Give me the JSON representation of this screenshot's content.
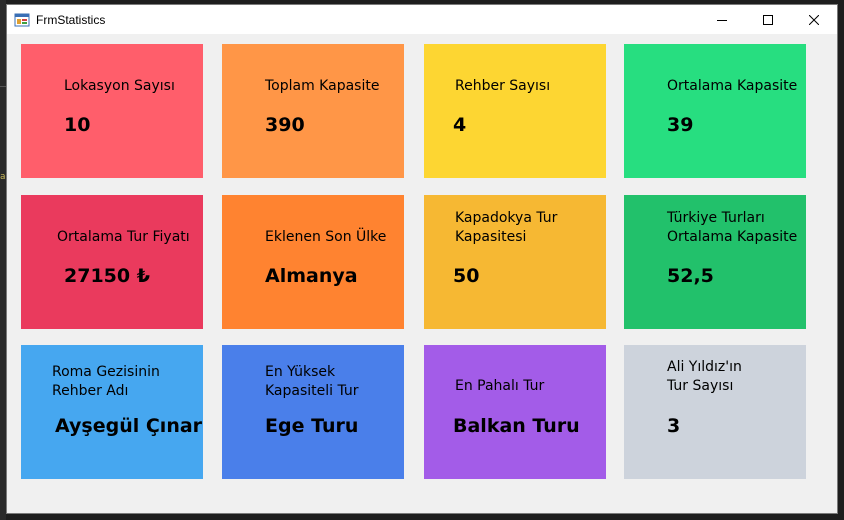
{
  "window": {
    "title": "FrmStatistics",
    "controls": {
      "minimize_icon": "minimize-icon",
      "maximize_icon": "maximize-icon",
      "close_icon": "close-icon"
    }
  },
  "tiles": [
    {
      "label": "Lokasyon Sayısı",
      "value": "10",
      "color": "#ff5e6b"
    },
    {
      "label": "Toplam Kapasite",
      "value": "390",
      "color": "#ff9647"
    },
    {
      "label": "Rehber Sayısı",
      "value": "4",
      "color": "#fdd632"
    },
    {
      "label": "Ortalama Kapasite",
      "value": "39",
      "color": "#27de80"
    },
    {
      "label": "Ortalama Tur Fiyatı",
      "value": "27150 ₺",
      "color": "#ea3a5d"
    },
    {
      "label": "Eklenen Son Ülke",
      "value": "Almanya",
      "color": "#ff8330"
    },
    {
      "label": "Kapadokya Tur\nKapasitesi",
      "value": "50",
      "color": "#f6b833"
    },
    {
      "label": "Türkiye Turları\nOrtalama Kapasite",
      "value": "52,5",
      "color": "#22c16b"
    },
    {
      "label": "Roma Gezisinin\nRehber Adı",
      "value": "Ayşegül Çınar",
      "color": "#46a7f0"
    },
    {
      "label": "En Yüksek\nKapasiteli Tur",
      "value": "Ege Turu",
      "color": "#4a7fea"
    },
    {
      "label": "En Pahalı Tur",
      "value": "Balkan Turu",
      "color": "#a35ce8"
    },
    {
      "label": "Ali Yıldız'ın\nTur Sayısı",
      "value": "3",
      "color": "#cdd3dc"
    }
  ]
}
